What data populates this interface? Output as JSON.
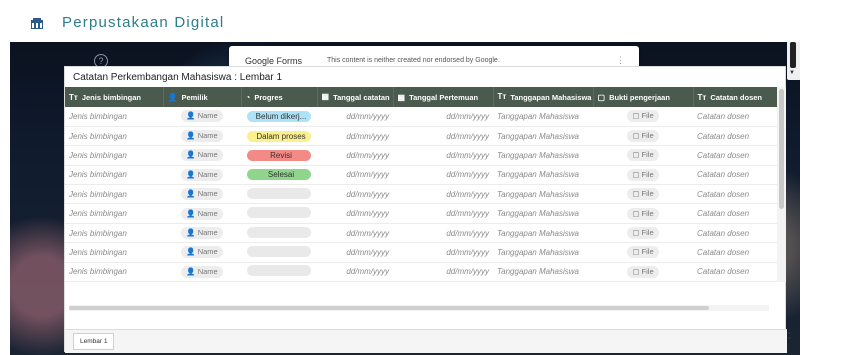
{
  "header": {
    "brand": "Perpustakaan Digital"
  },
  "gforms": {
    "name": "Google Forms",
    "note": "This content is neither created nor endorsed by Google."
  },
  "sheet": {
    "title": "Catatan Perkembangan Mahasiswa : Lembar 1",
    "tab": "Lembar 1",
    "columns": [
      {
        "icon": "Tт",
        "label": "Jenis bimbingan"
      },
      {
        "icon": "👤",
        "label": "Pemilik"
      },
      {
        "icon": "◔",
        "label": "Progres"
      },
      {
        "icon": "▦",
        "label": "Tanggal catatan"
      },
      {
        "icon": "▦",
        "label": "Tanggal Pertemuan"
      },
      {
        "icon": "Tт",
        "label": "Tanggapan Mahasiswa"
      },
      {
        "icon": "▢",
        "label": "Bukti pengerjaan"
      },
      {
        "icon": "Tт",
        "label": "Catatan dosen"
      }
    ],
    "rows": [
      {
        "jenis": "Jenis bimbingan",
        "pemilik": "Name",
        "progres": "Belum dikerj...",
        "progres_color": "#aee3f7",
        "tgl_catatan": "dd/mm/yyyy",
        "tgl_pertemuan": "dd/mm/yyyy",
        "tanggapan": "Tanggapan Mahasiswa",
        "bukti": "File",
        "catatan": "Catatan dosen"
      },
      {
        "jenis": "Jenis bimbingan",
        "pemilik": "Name",
        "progres": "Dalam proses",
        "progres_color": "#fbf08e",
        "tgl_catatan": "dd/mm/yyyy",
        "tgl_pertemuan": "dd/mm/yyyy",
        "tanggapan": "Tanggapan Mahasiswa",
        "bukti": "File",
        "catatan": "Catatan dosen"
      },
      {
        "jenis": "Jenis bimbingan",
        "pemilik": "Name",
        "progres": "Revisi",
        "progres_color": "#f38a86",
        "tgl_catatan": "dd/mm/yyyy",
        "tgl_pertemuan": "dd/mm/yyyy",
        "tanggapan": "Tanggapan Mahasiswa",
        "bukti": "File",
        "catatan": "Catatan dosen"
      },
      {
        "jenis": "Jenis bimbingan",
        "pemilik": "Name",
        "progres": "Selesai",
        "progres_color": "#8fd68c",
        "tgl_catatan": "dd/mm/yyyy",
        "tgl_pertemuan": "dd/mm/yyyy",
        "tanggapan": "Tanggapan Mahasiswa",
        "bukti": "File",
        "catatan": "Catatan dosen"
      },
      {
        "jenis": "Jenis bimbingan",
        "pemilik": "Name",
        "progres": "",
        "progres_color": "#e9e9e9",
        "tgl_catatan": "dd/mm/yyyy",
        "tgl_pertemuan": "dd/mm/yyyy",
        "tanggapan": "Tanggapan Mahasiswa",
        "bukti": "File",
        "catatan": "Catatan dosen"
      },
      {
        "jenis": "Jenis bimbingan",
        "pemilik": "Name",
        "progres": "",
        "progres_color": "#e9e9e9",
        "tgl_catatan": "dd/mm/yyyy",
        "tgl_pertemuan": "dd/mm/yyyy",
        "tanggapan": "Tanggapan Mahasiswa",
        "bukti": "File",
        "catatan": "Catatan dosen"
      },
      {
        "jenis": "Jenis bimbingan",
        "pemilik": "Name",
        "progres": "",
        "progres_color": "#e9e9e9",
        "tgl_catatan": "dd/mm/yyyy",
        "tgl_pertemuan": "dd/mm/yyyy",
        "tanggapan": "Tanggapan Mahasiswa",
        "bukti": "File",
        "catatan": "Catatan dosen"
      },
      {
        "jenis": "Jenis bimbingan",
        "pemilik": "Name",
        "progres": "",
        "progres_color": "#e9e9e9",
        "tgl_catatan": "dd/mm/yyyy",
        "tgl_pertemuan": "dd/mm/yyyy",
        "tanggapan": "Tanggapan Mahasiswa",
        "bukti": "File",
        "catatan": "Catatan dosen"
      },
      {
        "jenis": "Jenis bimbingan",
        "pemilik": "Name",
        "progres": "",
        "progres_color": "#e9e9e9",
        "tgl_catatan": "dd/mm/yyyy",
        "tgl_pertemuan": "dd/mm/yyyy",
        "tanggapan": "Tanggapan Mahasiswa",
        "bukti": "File",
        "catatan": "Catatan dosen"
      }
    ]
  },
  "icons": {
    "help": "help-circle-icon",
    "more": "more-vertical-icon",
    "logo": "library-logo-icon"
  }
}
